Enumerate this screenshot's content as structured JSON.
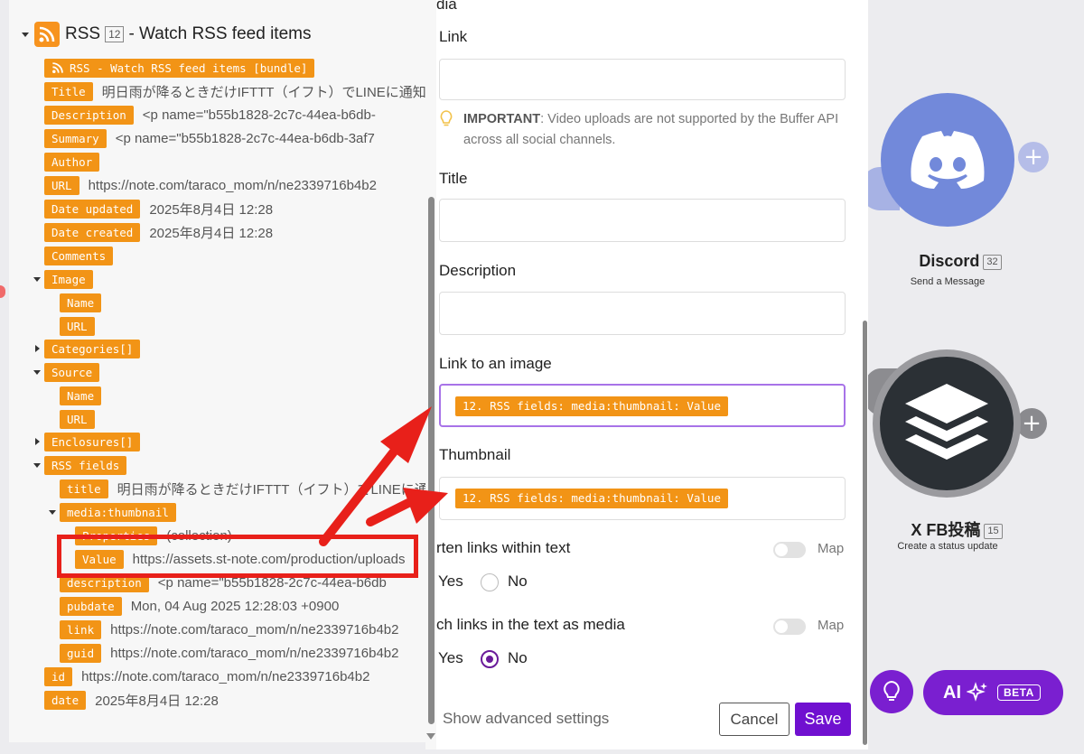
{
  "canvas": {
    "discord": {
      "name": "Discord",
      "badge": "32",
      "action": "Send a Message"
    },
    "buffer": {
      "name": "X FB投稿",
      "badge": "15",
      "action": "Create a status update"
    },
    "plus_symbol": "+"
  },
  "mapping_panel": {
    "header": {
      "title": "RSS",
      "badge": "12",
      "suffix": "- Watch RSS feed items"
    },
    "bundle_label": "RSS - Watch RSS feed items [bundle]",
    "rows": {
      "title": {
        "label": "Title",
        "value": "明日雨が降るときだけIFTTT（イフト）でLINEに通知を"
      },
      "description": {
        "label": "Description",
        "value": "<p name=\"b55b1828-2c7c-44ea-b6db-"
      },
      "summary": {
        "label": "Summary",
        "value": "<p name=\"b55b1828-2c7c-44ea-b6db-3af7"
      },
      "author": {
        "label": "Author"
      },
      "url": {
        "label": "URL",
        "value": "https://note.com/taraco_mom/n/ne2339716b4b2"
      },
      "date_updated": {
        "label": "Date updated",
        "value": "2025年8月4日 12:28"
      },
      "date_created": {
        "label": "Date created",
        "value": "2025年8月4日 12:28"
      },
      "comments": {
        "label": "Comments"
      },
      "image": {
        "label": "Image"
      },
      "image_name": {
        "label": "Name"
      },
      "image_url": {
        "label": "URL"
      },
      "categories": {
        "label": "Categories[]"
      },
      "source": {
        "label": "Source"
      },
      "source_name": {
        "label": "Name"
      },
      "source_url": {
        "label": "URL"
      },
      "enclosures": {
        "label": "Enclosures[]"
      },
      "rss_fields": {
        "label": "RSS fields"
      },
      "rss_title": {
        "label": "title",
        "value": "明日雨が降るときだけIFTTT（イフト）でLINEに通知を"
      },
      "media_thumbnail": {
        "label": "media:thumbnail"
      },
      "properties": {
        "label": "Properties",
        "value": "(collection)"
      },
      "value": {
        "label": "Value",
        "value": "https://assets.st-note.com/production/uploads"
      },
      "rss_description": {
        "label": "description",
        "value": "<p name=\"b55b1828-2c7c-44ea-b6db"
      },
      "pubdate": {
        "label": "pubdate",
        "value": "Mon, 04 Aug 2025 12:28:03 +0900"
      },
      "link": {
        "label": "link",
        "value": "https://note.com/taraco_mom/n/ne2339716b4b2"
      },
      "guid": {
        "label": "guid",
        "value": "https://note.com/taraco_mom/n/ne2339716b4b2"
      },
      "id": {
        "label": "id",
        "value": "https://note.com/taraco_mom/n/ne2339716b4b2"
      },
      "date": {
        "label": "date",
        "value": "2025年8月4日 12:28"
      }
    }
  },
  "settings_panel": {
    "top_cut_label": "dia",
    "link_label": "Link",
    "important_prefix": "IMPORTANT",
    "important_text": ": Video uploads are not supported by the Buffer API across all social channels.",
    "title_label": "Title",
    "description_label": "Description",
    "image_link_label": "Link to an image",
    "image_link_value": "12. RSS fields: media:thumbnail: Value",
    "thumbnail_label": "Thumbnail",
    "thumbnail_value": "12. RSS fields: media:thumbnail: Value",
    "shorten_label": "rten links within text",
    "attach_label": "ch links in the text as media",
    "map_label": "Map",
    "yes_label": "Yes",
    "no_label": "No",
    "advanced_link": "Show advanced settings",
    "cancel_label": "Cancel",
    "save_label": "Save"
  },
  "assistant": {
    "ai_label": "AI",
    "beta_label": "BETA"
  },
  "colors": {
    "pill_orange": "#f29416",
    "highlight_red": "#e8201a",
    "accent_purple": "#7010d0",
    "discord_blue": "#7289da",
    "buffer_dark": "#2b3035"
  }
}
